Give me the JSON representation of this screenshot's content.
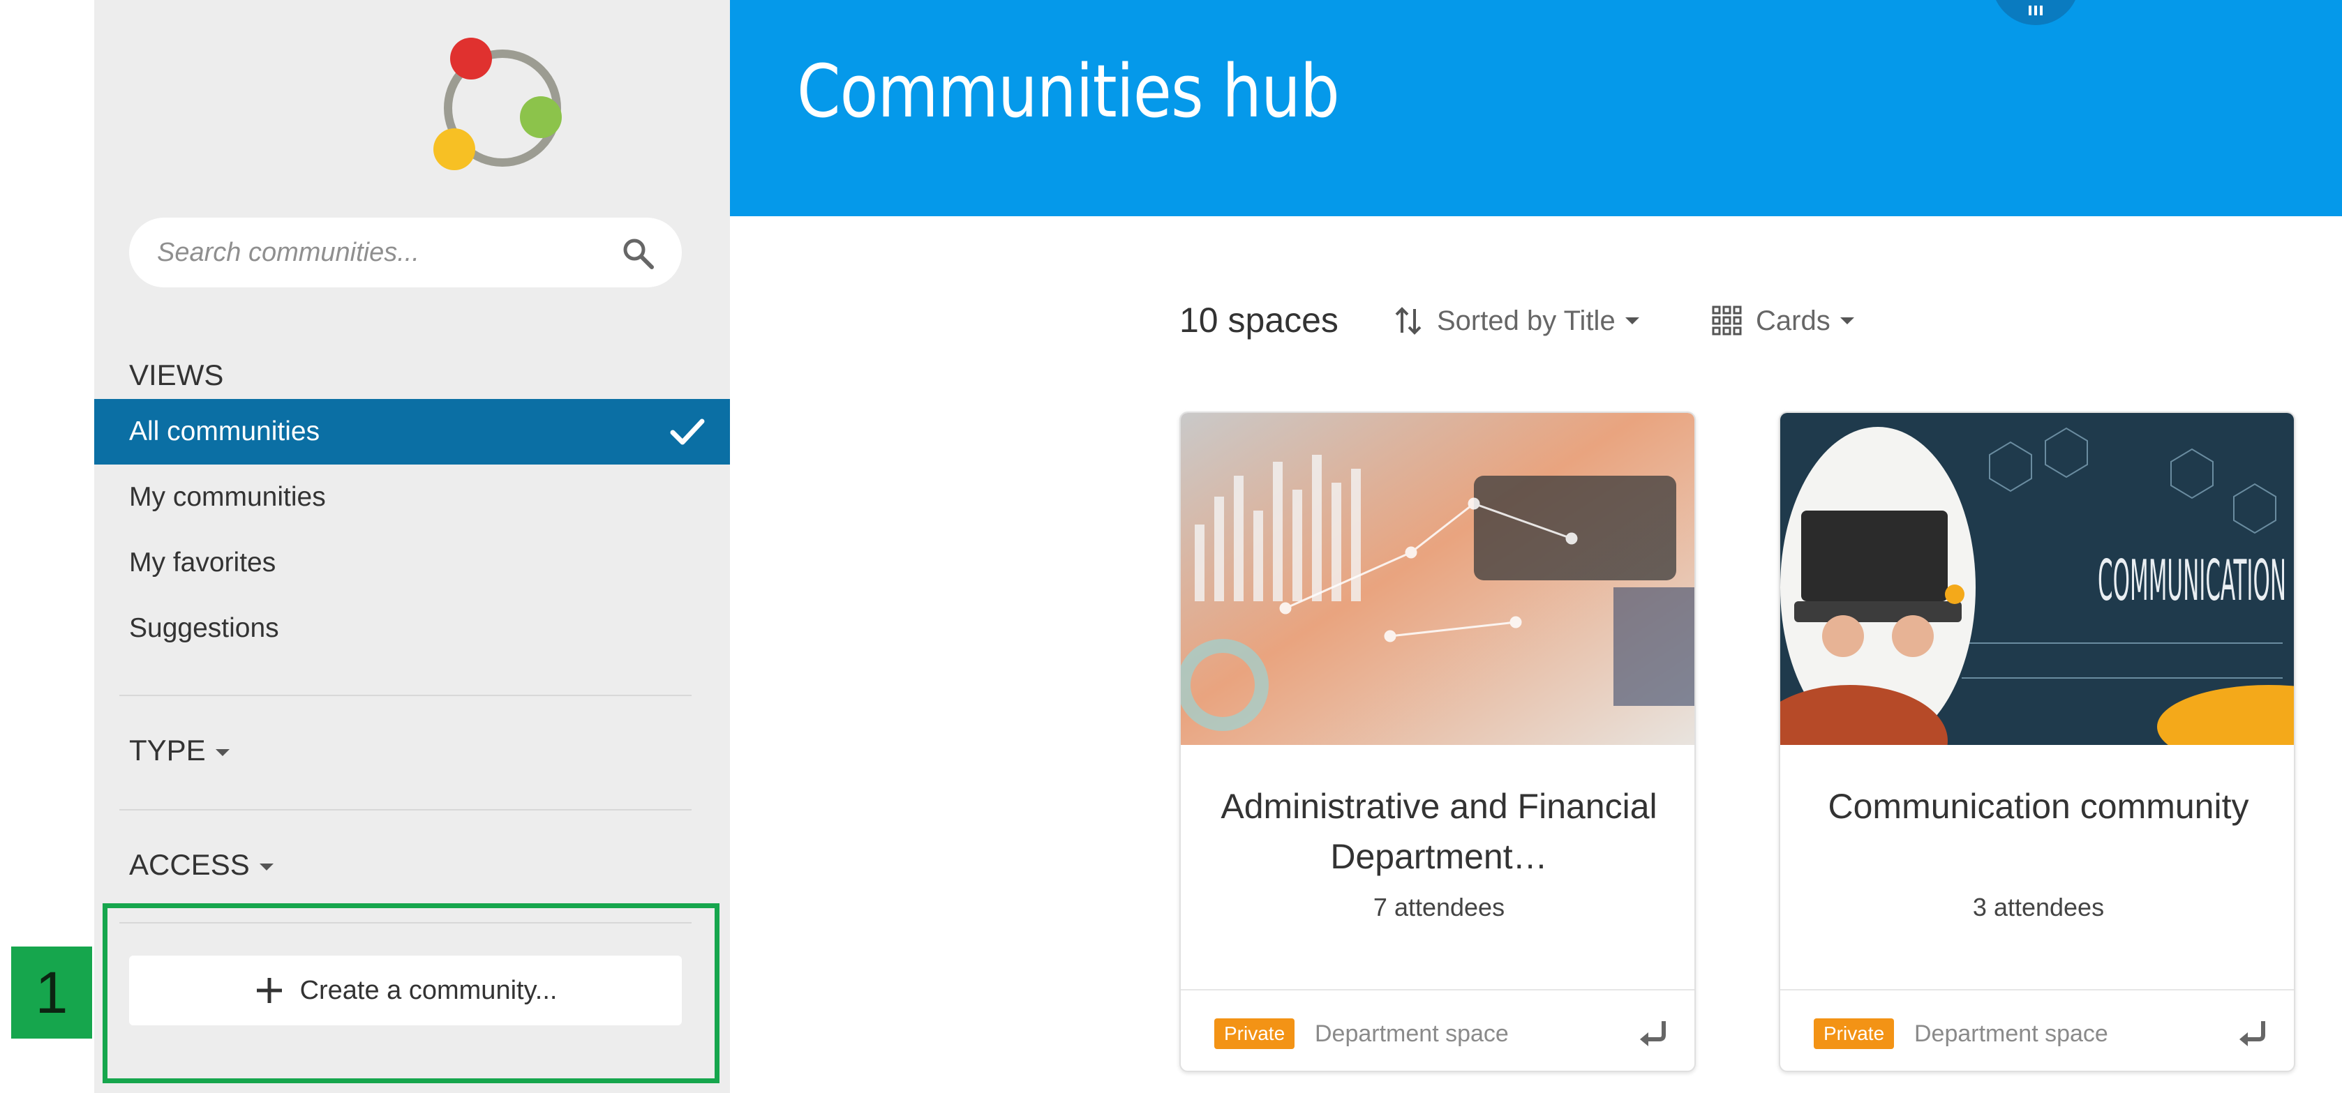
{
  "sidebar": {
    "search": {
      "placeholder": "Search communities..."
    },
    "views": {
      "heading": "VIEWS",
      "items": [
        {
          "label": "All communities",
          "active": true
        },
        {
          "label": "My communities"
        },
        {
          "label": "My favorites"
        },
        {
          "label": "Suggestions"
        }
      ]
    },
    "filters": {
      "type_label": "TYPE",
      "access_label": "ACCESS"
    },
    "create_button_label": "Create a community...",
    "step_marker": "1"
  },
  "header": {
    "title": "Communities hub"
  },
  "toolbar": {
    "count_label": "10 spaces",
    "sort_label": "Sorted by Title",
    "view_label": "Cards"
  },
  "cards": [
    {
      "title": "Administrative and Financial Department…",
      "attendees": "7 attendees",
      "badge": "Private",
      "space_type": "Department space"
    },
    {
      "title": "Communication community",
      "attendees": "3 attendees",
      "badge": "Private",
      "space_type": "Department space"
    }
  ],
  "colors": {
    "header_blue": "#0599ea",
    "active_nav": "#0b6fa4",
    "highlight_green": "#16a64d",
    "badge_orange": "#f39315"
  }
}
